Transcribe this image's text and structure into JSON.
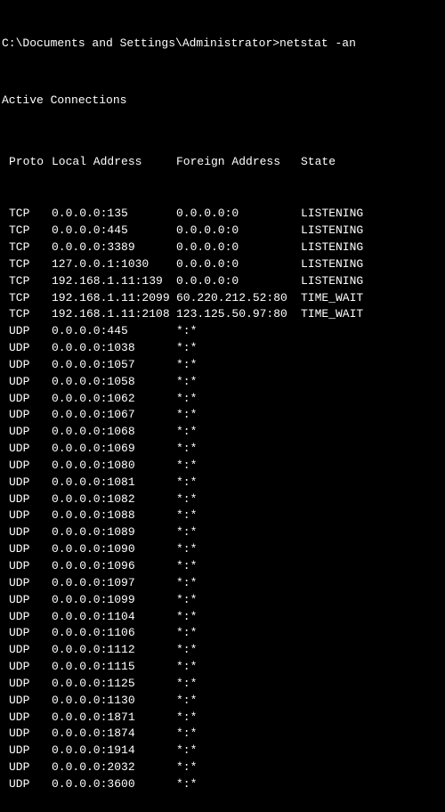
{
  "prompt": "C:\\Documents and Settings\\Administrator>netstat -an",
  "header": "Active Connections",
  "columns": {
    "proto": "Proto",
    "local": "Local Address",
    "foreign": "Foreign Address",
    "state": "State"
  },
  "rows": [
    {
      "proto": "TCP",
      "local": "0.0.0.0:135",
      "foreign": "0.0.0.0:0",
      "state": "LISTENING"
    },
    {
      "proto": "TCP",
      "local": "0.0.0.0:445",
      "foreign": "0.0.0.0:0",
      "state": "LISTENING"
    },
    {
      "proto": "TCP",
      "local": "0.0.0.0:3389",
      "foreign": "0.0.0.0:0",
      "state": "LISTENING"
    },
    {
      "proto": "TCP",
      "local": "127.0.0.1:1030",
      "foreign": "0.0.0.0:0",
      "state": "LISTENING"
    },
    {
      "proto": "TCP",
      "local": "192.168.1.11:139",
      "foreign": "0.0.0.0:0",
      "state": "LISTENING"
    },
    {
      "proto": "TCP",
      "local": "192.168.1.11:2099",
      "foreign": "60.220.212.52:80",
      "state": "TIME_WAIT"
    },
    {
      "proto": "TCP",
      "local": "192.168.1.11:2108",
      "foreign": "123.125.50.97:80",
      "state": "TIME_WAIT"
    },
    {
      "proto": "UDP",
      "local": "0.0.0.0:445",
      "foreign": "*:*",
      "state": ""
    },
    {
      "proto": "UDP",
      "local": "0.0.0.0:1038",
      "foreign": "*:*",
      "state": ""
    },
    {
      "proto": "UDP",
      "local": "0.0.0.0:1057",
      "foreign": "*:*",
      "state": ""
    },
    {
      "proto": "UDP",
      "local": "0.0.0.0:1058",
      "foreign": "*:*",
      "state": ""
    },
    {
      "proto": "UDP",
      "local": "0.0.0.0:1062",
      "foreign": "*:*",
      "state": ""
    },
    {
      "proto": "UDP",
      "local": "0.0.0.0:1067",
      "foreign": "*:*",
      "state": ""
    },
    {
      "proto": "UDP",
      "local": "0.0.0.0:1068",
      "foreign": "*:*",
      "state": ""
    },
    {
      "proto": "UDP",
      "local": "0.0.0.0:1069",
      "foreign": "*:*",
      "state": ""
    },
    {
      "proto": "UDP",
      "local": "0.0.0.0:1080",
      "foreign": "*:*",
      "state": ""
    },
    {
      "proto": "UDP",
      "local": "0.0.0.0:1081",
      "foreign": "*:*",
      "state": ""
    },
    {
      "proto": "UDP",
      "local": "0.0.0.0:1082",
      "foreign": "*:*",
      "state": ""
    },
    {
      "proto": "UDP",
      "local": "0.0.0.0:1088",
      "foreign": "*:*",
      "state": ""
    },
    {
      "proto": "UDP",
      "local": "0.0.0.0:1089",
      "foreign": "*:*",
      "state": ""
    },
    {
      "proto": "UDP",
      "local": "0.0.0.0:1090",
      "foreign": "*:*",
      "state": ""
    },
    {
      "proto": "UDP",
      "local": "0.0.0.0:1096",
      "foreign": "*:*",
      "state": ""
    },
    {
      "proto": "UDP",
      "local": "0.0.0.0:1097",
      "foreign": "*:*",
      "state": ""
    },
    {
      "proto": "UDP",
      "local": "0.0.0.0:1099",
      "foreign": "*:*",
      "state": ""
    },
    {
      "proto": "UDP",
      "local": "0.0.0.0:1104",
      "foreign": "*:*",
      "state": ""
    },
    {
      "proto": "UDP",
      "local": "0.0.0.0:1106",
      "foreign": "*:*",
      "state": ""
    },
    {
      "proto": "UDP",
      "local": "0.0.0.0:1112",
      "foreign": "*:*",
      "state": ""
    },
    {
      "proto": "UDP",
      "local": "0.0.0.0:1115",
      "foreign": "*:*",
      "state": ""
    },
    {
      "proto": "UDP",
      "local": "0.0.0.0:1125",
      "foreign": "*:*",
      "state": ""
    },
    {
      "proto": "UDP",
      "local": "0.0.0.0:1130",
      "foreign": "*:*",
      "state": ""
    },
    {
      "proto": "UDP",
      "local": "0.0.0.0:1871",
      "foreign": "*:*",
      "state": ""
    },
    {
      "proto": "UDP",
      "local": "0.0.0.0:1874",
      "foreign": "*:*",
      "state": ""
    },
    {
      "proto": "UDP",
      "local": "0.0.0.0:1914",
      "foreign": "*:*",
      "state": ""
    },
    {
      "proto": "UDP",
      "local": "0.0.0.0:2032",
      "foreign": "*:*",
      "state": ""
    },
    {
      "proto": "UDP",
      "local": "0.0.0.0:3600",
      "foreign": "*:*",
      "state": ""
    }
  ]
}
